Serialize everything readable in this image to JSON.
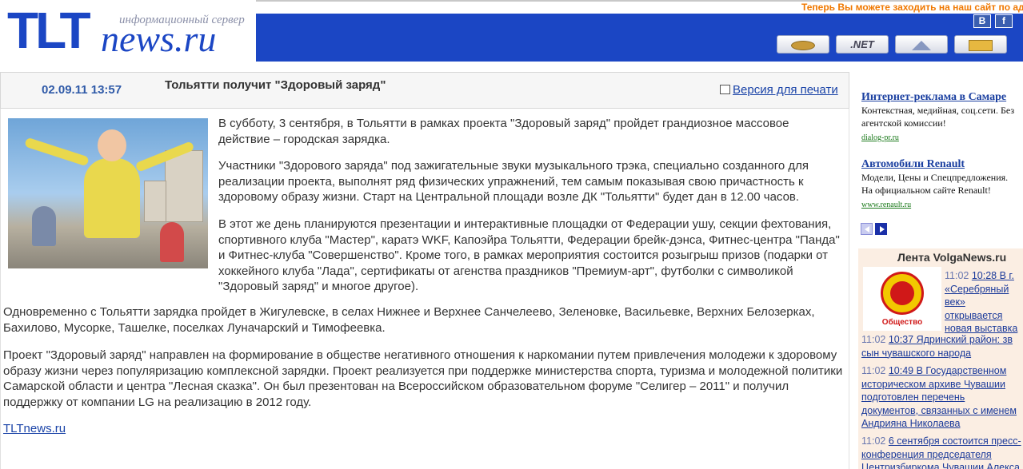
{
  "header": {
    "logo_tlt": "TLT",
    "logo_news": "news.ru",
    "logo_subtitle": "информационный сервер",
    "ticker": "Теперь Вы можете заходить на наш сайт по адр",
    "social": [
      "В",
      "f"
    ],
    "nav_buttons": [
      {
        "label": "",
        "icon": "coin-icon"
      },
      {
        "label": ".NET",
        "icon": "net-icon"
      },
      {
        "label": "",
        "icon": "home-icon"
      },
      {
        "label": "",
        "icon": "mail-icon"
      }
    ]
  },
  "article": {
    "date": "02.09.11 13:57",
    "title": "Тольятти получит \"Здоровый заряд\"",
    "print_label": "Версия для печати",
    "paragraphs": [
      "В субботу, 3 сентября, в Тольятти в рамках проекта \"Здоровый заряд\" пройдет грандиозное массовое действие – городская зарядка.",
      "Участники \"Здорового заряда\" под зажигательные звуки музыкального трэка, специально созданного для реализации проекта, выполнят ряд физических упражнений, тем самым показывая свою причастность к здоровому образу жизни. Старт на Центральной площади возле ДК \"Тольятти\" будет дан в 12.00 часов.",
      "В этот же день планируются презентации и интерактивные площадки от Федерации ушу, секции фехтования, спортивного клуба \"Мастер\", каратэ WKF, Капоэйра Тольятти, Федерации брейк-дэнса, Фитнес-центра \"Панда\" и Фитнес-клуба \"Совершенство\". Кроме того, в рамках мероприятия состоится розыгрыш призов (подарки от хоккейного клуба \"Лада\", сертификаты от агенства праздников \"Премиум-арт\", футболки с символикой \"Здоровый заряд\" и многое другое).",
      "Одновременно с Тольятти зарядка пройдет в Жигулевске, в селах Нижнее и Верхнее Санчелеево, Зеленовке, Васильевке, Верхних Белозерках, Бахилово, Мусорке, Ташелке, поселках Луначарский и Тимофеевка.",
      "Проект \"Здоровый заряд\" направлен на формирование в обществе негативного отношения к наркомании путем привлечения молодежи к здоровому образу жизни через популяризацию комплексной зарядки. Проект реализуется при поддержке министерства спорта, туризма и молодежной политики Самарской области и центра \"Лесная сказка\". Он был презентован на Всероссийском образовательном форуме \"Селигер – 2011\" и получил поддержку от компании LG на реализацию в 2012 году."
    ],
    "source": "TLTnews.ru"
  },
  "ads": [
    {
      "title": "Интернет-реклама в Самаре",
      "text": "Контекстная, медийная, соц.сети. Без агентской комиссии!",
      "url": "dialog-pr.ru"
    },
    {
      "title": "Автомобили Renault",
      "text": "Модели, Цены и Спецпредложения. На официальном сайте Renault!",
      "url": "www.renault.ru"
    }
  ],
  "feed": {
    "title": "Лента VolgaNews.ru",
    "emblem_label": "Общество",
    "items": [
      {
        "time": "11:02",
        "text": "10:28 В г. «Серебряный век» открывается новая выставка"
      },
      {
        "time": "11:02",
        "text": "10:37 Ядринский район: зв сын чувашского народа"
      },
      {
        "time": "11:02",
        "text": "10:49 В Государственном историческом архиве Чувашии подготовлен перечень документов, связанных с именем Андрияна Николаева"
      },
      {
        "time": "11:02",
        "text": "6 сентября состоится пресс-конференция председателя Центризбиркома Чувашии Алекса"
      }
    ]
  },
  "colors": {
    "brand_blue": "#1b46c4",
    "ticker_orange": "#f07800",
    "link_blue": "#1b44a8",
    "feed_bg": "#fbeee3"
  }
}
